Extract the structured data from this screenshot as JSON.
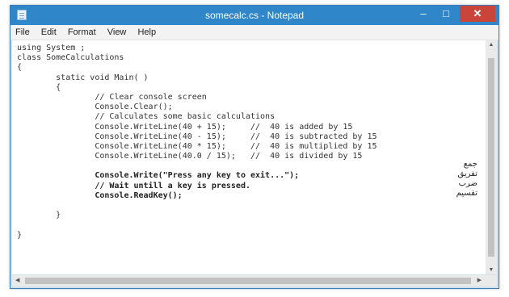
{
  "window": {
    "title": "somecalc.cs - Notepad",
    "min_glyph": "–",
    "max_glyph": "□",
    "close_glyph": "✕"
  },
  "menu": [
    "File",
    "Edit",
    "Format",
    "View",
    "Help"
  ],
  "code_lines": [
    "using System ;",
    "class SomeCalculations",
    "{",
    "        static void Main( )",
    "        {",
    "                // Clear console screen",
    "                Console.Clear();",
    "                // Calculates some basic calculations",
    "                Console.WriteLine(40 + 15);     //  40 is added by 15",
    "                Console.WriteLine(40 - 15);     //  40 is subtracted by 15",
    "                Console.WriteLine(40 * 15);     //  40 is multiplied by 15",
    "                Console.WriteLine(40.0 / 15);   //  40 is divided by 15",
    "",
    "                Console.Write(\"Press any key to exit...\");",
    "                // Wait untill a key is pressed.",
    "                Console.ReadKey();",
    "",
    "        }",
    "",
    "}"
  ],
  "bold_lines": [
    13,
    14,
    15
  ],
  "operation_labels": [
    "جمع",
    "تفریق",
    "ضرب",
    "تقسیم"
  ],
  "icons": {
    "app": "notepad-icon",
    "scroll_up": "▲",
    "scroll_down": "▼",
    "scroll_left": "◀",
    "scroll_right": "▶"
  }
}
